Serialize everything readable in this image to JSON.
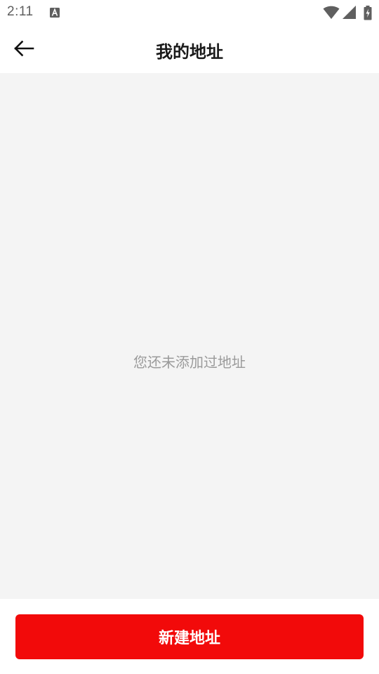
{
  "status_bar": {
    "time": "2:11",
    "icons": [
      "notification-a-icon",
      "wifi-icon",
      "cellular-signal-icon",
      "battery-charging-icon"
    ]
  },
  "header": {
    "title": "我的地址",
    "back_icon": "arrow-left-icon"
  },
  "main": {
    "empty_message": "您还未添加过地址"
  },
  "footer": {
    "add_button_label": "新建地址"
  },
  "colors": {
    "accent": "#f20a0a",
    "content_background": "#f4f4f4",
    "empty_text": "#9a9a9a"
  }
}
